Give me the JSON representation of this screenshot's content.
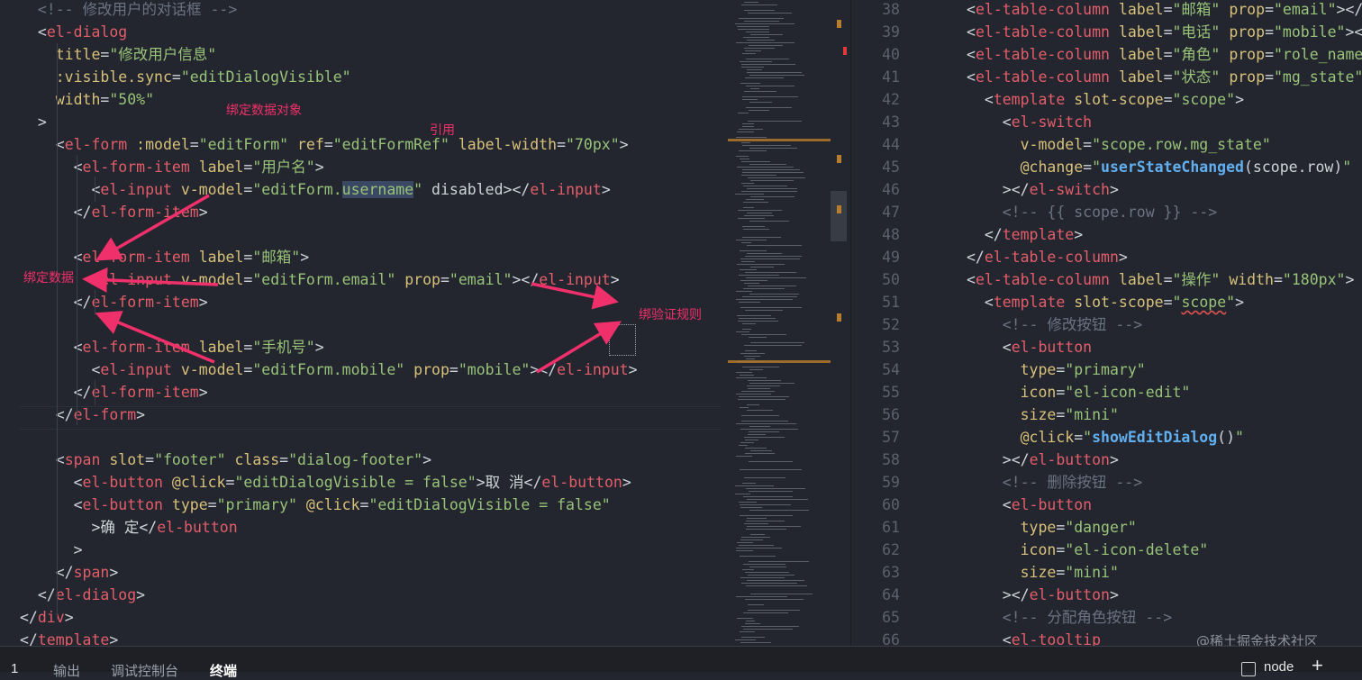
{
  "left_code": [
    "  <!-- 修改用户的对话框 -->",
    "  <el-dialog",
    "    title=\"修改用户信息\"",
    "    :visible.sync=\"editDialogVisible\"",
    "    width=\"50%\"",
    "  >",
    "    <el-form :model=\"editForm\" ref=\"editFormRef\" label-width=\"70px\">",
    "      <el-form-item label=\"用户名\">",
    "        <el-input v-model=\"editForm.username\" disabled></el-input>",
    "      </el-form-item>",
    "",
    "      <el-form-item label=\"邮箱\">",
    "        <el-input v-model=\"editForm.email\" prop=\"email\"></el-input>",
    "      </el-form-item>",
    "",
    "      <el-form-item label=\"手机号\">",
    "        <el-input v-model=\"editForm.mobile\" prop=\"mobile\"></el-input>",
    "      </el-form-item>",
    "    </el-form>",
    "",
    "    <span slot=\"footer\" class=\"dialog-footer\">",
    "      <el-button @click=\"editDialogVisible = false\">取 消</el-button>",
    "      <el-button type=\"primary\" @click=\"editDialogVisible = false\"",
    "        >确 定</el-button",
    "      >",
    "    </span>",
    "  </el-dialog>",
    "</div>",
    "</template>"
  ],
  "right_code": [
    {
      "n": "38",
      "text": "<el-table-column label=\"邮箱\" prop=\"email\"></el-table-column>"
    },
    {
      "n": "39",
      "text": "<el-table-column label=\"电话\" prop=\"mobile\"></el-table-column>"
    },
    {
      "n": "40",
      "text": "<el-table-column label=\"角色\" prop=\"role_name\"></el-table-column>"
    },
    {
      "n": "41",
      "text": "<el-table-column label=\"状态\" prop=\"mg_state\">"
    },
    {
      "n": "42",
      "text": "  <template slot-scope=\"scope\">"
    },
    {
      "n": "43",
      "text": "    <el-switch"
    },
    {
      "n": "44",
      "text": "      v-model=\"scope.row.mg_state\""
    },
    {
      "n": "45",
      "text": "      @change=\"userStateChanged(scope.row)\""
    },
    {
      "n": "46",
      "text": "    ></el-switch>"
    },
    {
      "n": "47",
      "text": "    <!-- {{ scope.row }} -->"
    },
    {
      "n": "48",
      "text": "  </template>"
    },
    {
      "n": "49",
      "text": "</el-table-column>"
    },
    {
      "n": "50",
      "text": "<el-table-column label=\"操作\" width=\"180px\">"
    },
    {
      "n": "51",
      "text": "  <template slot-scope=\"scope\">"
    },
    {
      "n": "52",
      "text": "    <!-- 修改按钮 -->"
    },
    {
      "n": "53",
      "text": "    <el-button"
    },
    {
      "n": "54",
      "text": "      type=\"primary\""
    },
    {
      "n": "55",
      "text": "      icon=\"el-icon-edit\""
    },
    {
      "n": "56",
      "text": "      size=\"mini\""
    },
    {
      "n": "57",
      "text": "      @click=\"showEditDialog()\""
    },
    {
      "n": "58",
      "text": "    ></el-button>"
    },
    {
      "n": "59",
      "text": "    <!-- 删除按钮 -->"
    },
    {
      "n": "60",
      "text": "    <el-button"
    },
    {
      "n": "61",
      "text": "      type=\"danger\""
    },
    {
      "n": "62",
      "text": "      icon=\"el-icon-delete\""
    },
    {
      "n": "63",
      "text": "      size=\"mini\""
    },
    {
      "n": "64",
      "text": "    ></el-button>"
    },
    {
      "n": "65",
      "text": "    <!-- 分配角色按钮 -->"
    },
    {
      "n": "66",
      "text": "    <el-tooltip"
    }
  ],
  "annotations": {
    "bind_model": "绑定数据对象",
    "reference": "引用",
    "bind_data": "绑定数据",
    "bind_rules": "绑验证规则"
  },
  "annotation_color": "#f0306a",
  "panel": {
    "left_number": "1",
    "tabs": [
      "输出",
      "调试控制台",
      "终端"
    ],
    "active_tab": "终端",
    "terminal_name": "node",
    "add_symbol": "+"
  },
  "watermark": "@稀土掘金技术社区",
  "colors": {
    "background": "#23262e",
    "tag": "#e35d6a",
    "attribute": "#d8c17a",
    "string": "#98c379",
    "comment": "#6b7282",
    "function": "#61afef"
  }
}
